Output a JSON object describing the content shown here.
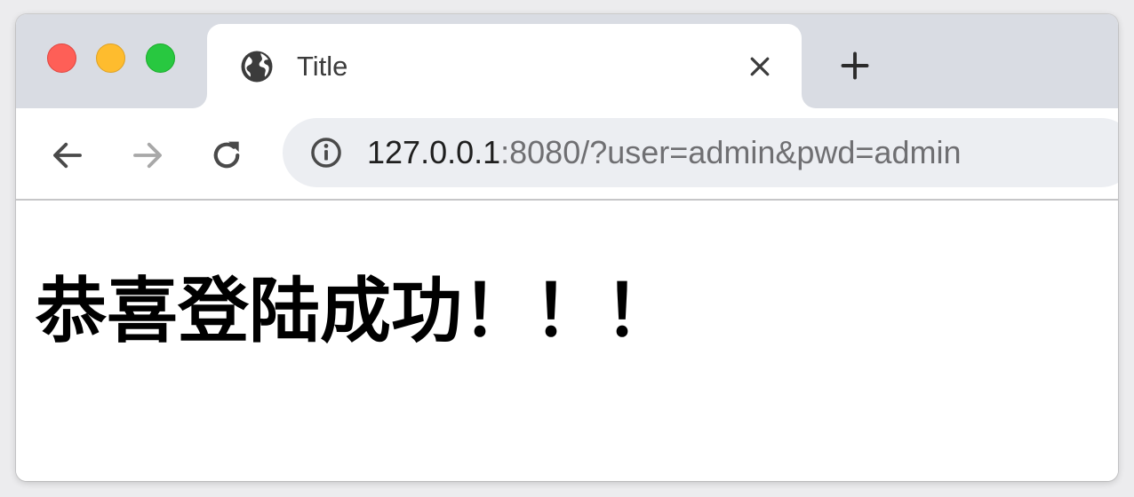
{
  "window": {
    "controls": {
      "close_color": "#fe5f57",
      "minimize_color": "#febc2e",
      "maximize_color": "#28c840"
    }
  },
  "tabs": [
    {
      "title": "Title",
      "favicon": "globe-icon",
      "active": true
    }
  ],
  "toolbar": {
    "back_icon": "arrow-left-icon",
    "forward_icon": "arrow-right-icon",
    "reload_icon": "reload-icon",
    "site_info_icon": "info-icon",
    "new_tab_icon": "plus-icon",
    "close_tab_icon": "close-icon"
  },
  "address_bar": {
    "host": "127.0.0.1",
    "rest": ":8080/?user=admin&pwd=admin"
  },
  "page": {
    "heading": "恭喜登陆成功！！！"
  }
}
